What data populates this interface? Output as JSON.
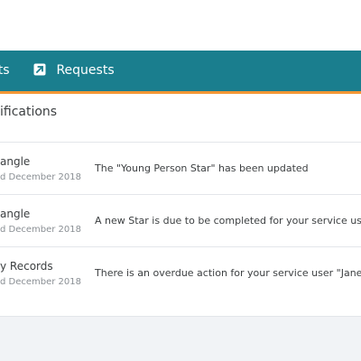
{
  "colors": {
    "nav_background": "#1a7e8e",
    "nav_accent": "#f29735",
    "page_background": "#f1f3f6"
  },
  "nav": {
    "items": [
      {
        "label": "rts",
        "icon": null
      },
      {
        "label": "Requests",
        "icon": "external-link-icon"
      }
    ]
  },
  "panel": {
    "title": "ifications"
  },
  "notifications": [
    {
      "sender": "angle",
      "date": "d December 2018",
      "message": "The \"Young Person Star\" has been updated"
    },
    {
      "sender": "angle",
      "date": "d December 2018",
      "message": "A new Star is due to be completed for your service user"
    },
    {
      "sender": "y Records",
      "date": "d December 2018",
      "message": "There is an overdue action for your service user \"Jane S"
    }
  ]
}
